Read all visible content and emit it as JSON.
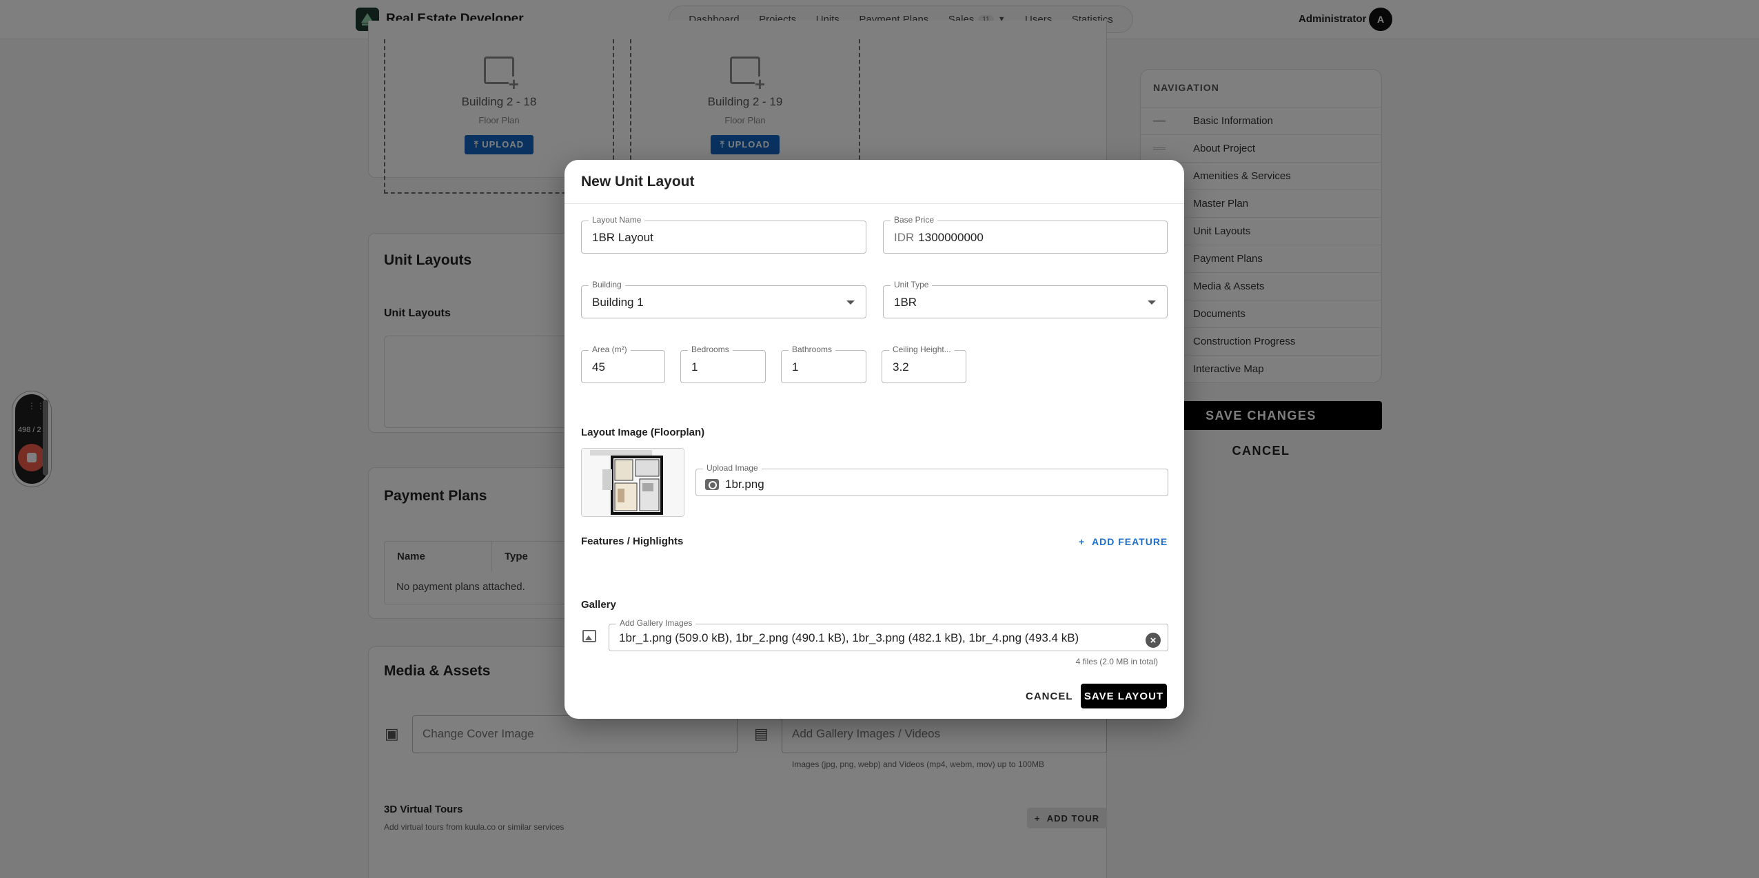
{
  "navbar": {
    "brand": "Real Estate Developer",
    "items": [
      {
        "label": "Dashboard"
      },
      {
        "label": "Projects"
      },
      {
        "label": "Units"
      },
      {
        "label": "Payment Plans"
      },
      {
        "label": "Sales",
        "badge": "11"
      },
      {
        "label": "Users"
      },
      {
        "label": "Statistics"
      }
    ],
    "user_name": "Administrator",
    "avatar_initial": "A"
  },
  "background": {
    "floor_plans": [
      {
        "name": "Building 2 - 18",
        "sub": "Floor Plan",
        "button": "UPLOAD"
      },
      {
        "name": "Building 2 - 19",
        "sub": "Floor Plan",
        "button": "UPLOAD"
      }
    ],
    "unit_layouts_title": "Unit Layouts",
    "unit_layouts_sub": "Unit Layouts",
    "payment_plans_title": "Payment Plans",
    "payment_table_headers": [
      "Name",
      "Type"
    ],
    "payment_empty": "No payment plans attached.",
    "media_title": "Media & Assets",
    "cover_placeholder": "Change Cover Image",
    "gallery_placeholder": "Add Gallery Images / Videos",
    "media_note": "Images (jpg, png, webp) and Videos (mp4, webm, mov) up to 100MB",
    "tours_title": "3D Virtual Tours",
    "tours_note": "Add virtual tours from kuula.co or similar services",
    "add_tour": "ADD TOUR"
  },
  "side_nav": {
    "title": "NAVIGATION",
    "items": [
      "Basic Information",
      "About Project",
      "Amenities & Services",
      "Master Plan",
      "Unit Layouts",
      "Payment Plans",
      "Media & Assets",
      "Documents",
      "Construction Progress",
      "Interactive Map"
    ],
    "save": "SAVE CHANGES",
    "cancel": "CANCEL"
  },
  "recorder": {
    "count": "498 / 2"
  },
  "modal": {
    "title": "New Unit Layout",
    "layout_name": {
      "label": "Layout Name",
      "value": "1BR Layout"
    },
    "base_price": {
      "label": "Base Price",
      "prefix": "IDR",
      "value": "1300000000"
    },
    "building": {
      "label": "Building",
      "value": "Building 1"
    },
    "unit_type": {
      "label": "Unit Type",
      "value": "1BR"
    },
    "area": {
      "label": "Area (m²)",
      "value": "45"
    },
    "bedrooms": {
      "label": "Bedrooms",
      "value": "1"
    },
    "bathrooms": {
      "label": "Bathrooms",
      "value": "1"
    },
    "ceiling": {
      "label": "Ceiling Height...",
      "value": "3.2"
    },
    "layout_image_title": "Layout Image (Floorplan)",
    "upload_image": {
      "label": "Upload Image",
      "value": "1br.png"
    },
    "features_title": "Features / Highlights",
    "add_feature": "ADD FEATURE",
    "gallery_title": "Gallery",
    "gallery": {
      "label": "Add Gallery Images",
      "value": "1br_1.png (509.0 kB), 1br_2.png (490.1 kB), 1br_3.png (482.1 kB), 1br_4.png (493.4 kB)"
    },
    "gallery_note": "4 files (2.0 MB in total)",
    "cancel": "CANCEL",
    "save": "SAVE LAYOUT"
  }
}
